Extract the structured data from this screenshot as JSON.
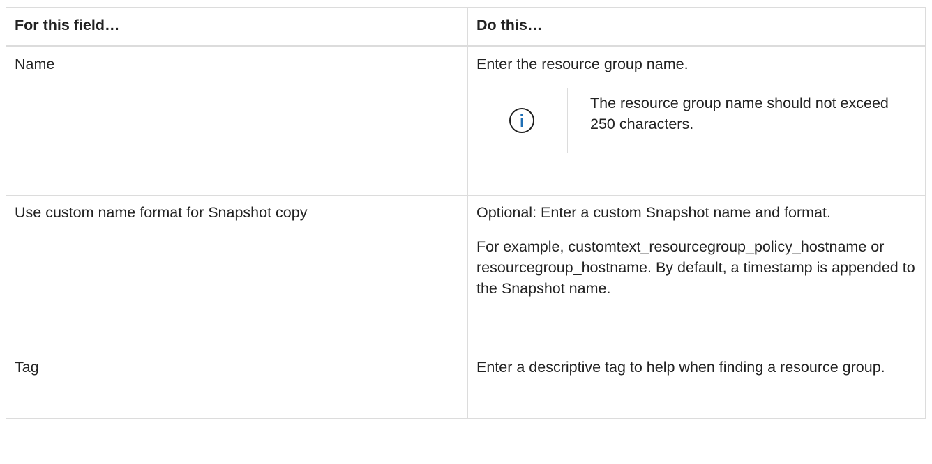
{
  "table": {
    "headers": [
      "For this field…",
      "Do this…"
    ],
    "rows": [
      {
        "field": "Name",
        "instruction": "Enter the resource group name.",
        "note": {
          "icon": "info-icon",
          "text": "The resource group name should not exceed 250 characters."
        }
      },
      {
        "field": "Use custom name format for Snapshot copy",
        "instruction": "Optional: Enter a custom Snapshot name and format.",
        "detail": "For example, customtext_resourcegroup_policy_hostname or resourcegroup_hostname. By default, a timestamp is appended to the Snapshot name."
      },
      {
        "field": "Tag",
        "instruction": "Enter a descriptive tag to help when finding a resource group."
      }
    ]
  },
  "colors": {
    "border": "#dcdcdc",
    "text": "#222222",
    "info_icon": "#1f6fb5"
  }
}
